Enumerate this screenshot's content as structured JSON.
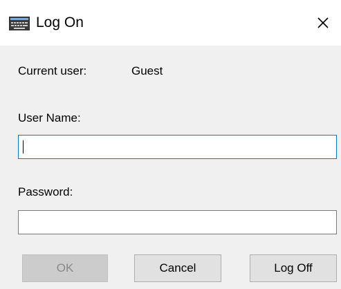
{
  "window": {
    "title": "Log On",
    "title_icon": "keyboard-icon",
    "close_icon": "close-icon"
  },
  "current_user": {
    "label": "Current user:",
    "value": "Guest"
  },
  "username": {
    "label": "User Name:",
    "value": "",
    "placeholder": "",
    "focused": true
  },
  "password": {
    "label": "Password:",
    "value": "",
    "placeholder": ""
  },
  "buttons": {
    "ok_label": "OK",
    "ok_enabled": false,
    "cancel_label": "Cancel",
    "logoff_label": "Log Off"
  },
  "colors": {
    "focus_border": "#0078d7",
    "button_face": "#e1e1e1",
    "dialog_background": "#f0f0f0"
  }
}
